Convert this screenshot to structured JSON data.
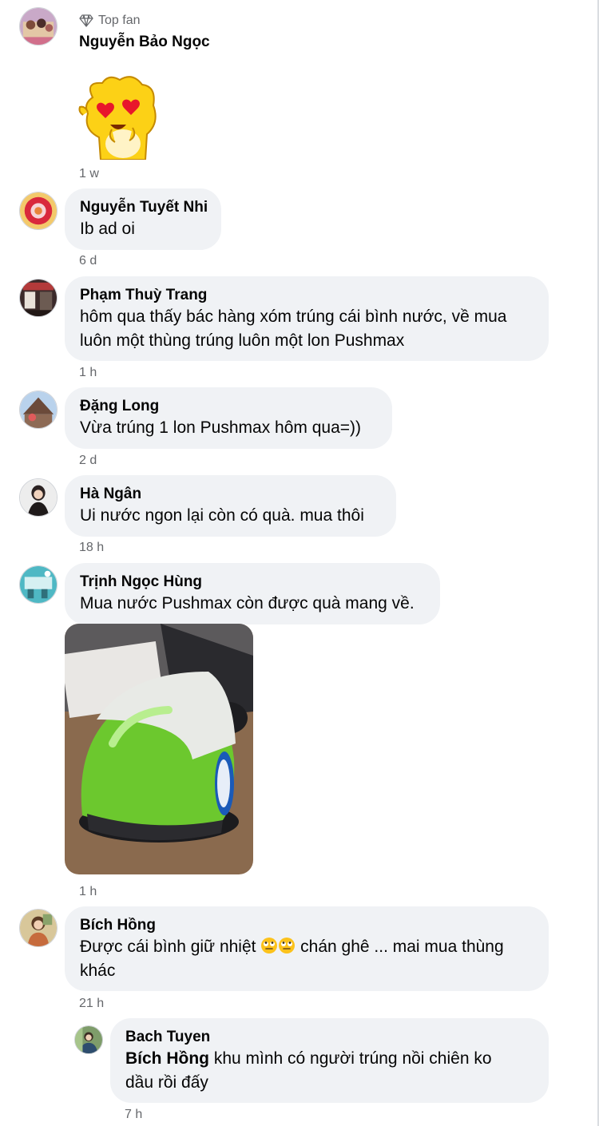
{
  "comments": [
    {
      "badge": "Top fan",
      "name": "Nguyễn Bảo Ngọc",
      "time": "1 w",
      "sticker": "yellow-blob-heart-eyes-sticker"
    },
    {
      "name": "Nguyễn Tuyết Nhi",
      "text": "Ib ad oi",
      "time": "6 d"
    },
    {
      "name": "Phạm Thuỳ Trang",
      "text_line1": "hôm qua thấy bác hàng xóm trúng cái bình nước, về mua",
      "text_line2": "luôn một thùng trúng luôn một lon Pushmax",
      "time": "1 h"
    },
    {
      "name": "Đặng Long",
      "text": "Vừa trúng 1 lon Pushmax hôm qua=))",
      "time": "2 d"
    },
    {
      "name": "Hà Ngân",
      "text": "Ui nước ngon lại còn có quà. mua thôi",
      "time": "18 h"
    },
    {
      "name": "Trịnh Ngọc Hùng",
      "text": "Mua nước Pushmax còn được quà mang về.",
      "time": "1 h",
      "photo": "green-helmet-photo"
    },
    {
      "name": "Bích Hồng",
      "text_part1": "Được cái bình giữ nhiệt ",
      "text_part2": " chán ghê ... mai mua thùng",
      "text_line2": "khác",
      "time": "21 h",
      "emoji": "face-with-rolling-eyes"
    },
    {
      "name": "Bach Tuyen",
      "mention": "Bích Hồng",
      "text_part1": " khu mình có người trúng nồi chiên ko",
      "text_line2": "dầu rồi đấy",
      "time": "7 h"
    }
  ],
  "colors": {
    "bubble": "#f0f2f5",
    "secondary_text": "#65676b",
    "primary_text": "#050505"
  }
}
